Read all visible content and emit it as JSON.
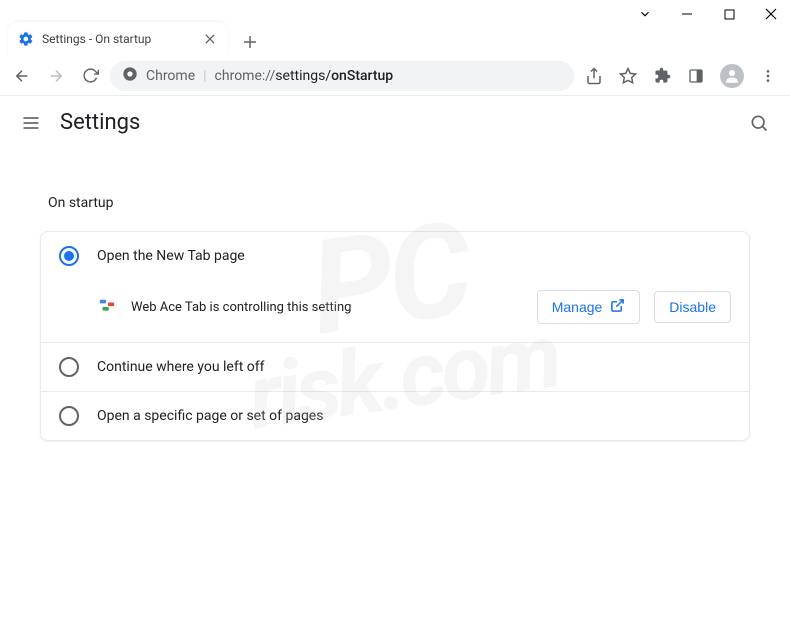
{
  "window": {
    "tab_title": "Settings - On startup"
  },
  "omnibox": {
    "scheme": "Chrome",
    "path_prefix": "chrome://",
    "path_mid": "settings/",
    "path_end": "onStartup"
  },
  "header": {
    "title": "Settings"
  },
  "section": {
    "title": "On startup"
  },
  "options": {
    "new_tab": "Open the New Tab page",
    "continue": "Continue where you left off",
    "specific": "Open a specific page or set of pages"
  },
  "extension": {
    "name": "Web Ace Tab",
    "message_suffix": " is controlling this setting",
    "manage_label": "Manage",
    "disable_label": "Disable"
  }
}
